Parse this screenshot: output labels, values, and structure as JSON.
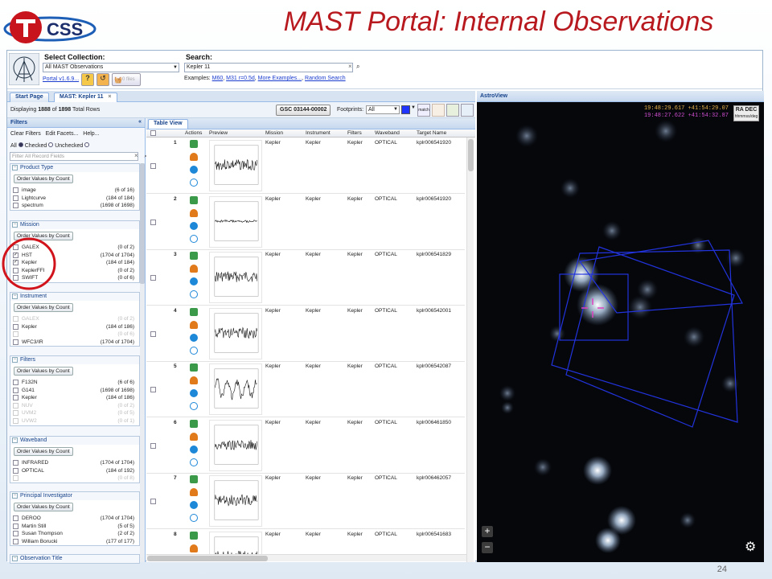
{
  "slide": {
    "title": "MAST Portal: Internal Observations",
    "number": "24",
    "logo_text": "TCSS"
  },
  "topbar": {
    "collection_label": "Select Collection:",
    "collection_value": "All MAST Observations",
    "portal_link": "Portal v1.6.9...",
    "files_btn": "0 files",
    "search_label": "Search:",
    "search_value": "Kepler 11",
    "examples_label": "Examples:",
    "examples": [
      "M60",
      "M31 r=0.5d",
      "More Examples...",
      "Random Search"
    ]
  },
  "tabs": [
    "Start Page",
    "MAST: Kepler 11"
  ],
  "infobar": {
    "displaying": "Displaying",
    "shown": "1888",
    "of": "of",
    "total": "1898",
    "rows_label": "Total Rows",
    "target_btn": "GSC 03144-00002",
    "footprints_label": "Footprints:",
    "footprints_value": "All",
    "match_label": "match"
  },
  "filters": {
    "title": "Filters",
    "clear": "Clear Filters",
    "edit": "Edit Facets...",
    "help": "Help...",
    "all": "All",
    "checked": "Checked",
    "unchecked": "Unchecked",
    "placeholder": "Filter All Record Fields",
    "order_btn": "Order Values by Count",
    "groups": [
      {
        "title": "Product Type",
        "items": [
          {
            "label": "image",
            "count": "(6 of 16)",
            "checked": false,
            "dim": false
          },
          {
            "label": "Lightcurve",
            "count": "(184 of 184)",
            "checked": false,
            "dim": false
          },
          {
            "label": "spectrum",
            "count": "(1698 of 1698)",
            "checked": false,
            "dim": false
          }
        ]
      },
      {
        "title": "Mission",
        "items": [
          {
            "label": "GALEX",
            "count": "(0 of 2)",
            "checked": false,
            "dim": false
          },
          {
            "label": "HST",
            "count": "(1704 of 1704)",
            "checked": true,
            "dim": false
          },
          {
            "label": "Kepler",
            "count": "(184 of 184)",
            "checked": true,
            "dim": false
          },
          {
            "label": "KeplerFFI",
            "count": "(0 of 2)",
            "checked": false,
            "dim": false
          },
          {
            "label": "SWIFT",
            "count": "(0 of 6)",
            "checked": false,
            "dim": false
          }
        ]
      },
      {
        "title": "Instrument",
        "items": [
          {
            "label": "GALEX",
            "count": "(0 of 2)",
            "checked": false,
            "dim": true
          },
          {
            "label": "Kepler",
            "count": "(184 of 186)",
            "checked": false,
            "dim": false
          },
          {
            "label": "",
            "count": "(0 of 6)",
            "checked": false,
            "dim": true
          },
          {
            "label": "WFC3/IR",
            "count": "(1704 of 1704)",
            "checked": false,
            "dim": false
          }
        ]
      },
      {
        "title": "Filters",
        "items": [
          {
            "label": "F132N",
            "count": "(6 of 6)",
            "checked": false,
            "dim": false
          },
          {
            "label": "G141",
            "count": "(1698 of 1698)",
            "checked": false,
            "dim": false
          },
          {
            "label": "Kepler",
            "count": "(184 of 186)",
            "checked": false,
            "dim": false
          },
          {
            "label": "NUV",
            "count": "(0 of 2)",
            "checked": false,
            "dim": true
          },
          {
            "label": "UVM2",
            "count": "(0 of 5)",
            "checked": false,
            "dim": true
          },
          {
            "label": "UVW2",
            "count": "(0 of 1)",
            "checked": false,
            "dim": true
          }
        ]
      },
      {
        "title": "Waveband",
        "items": [
          {
            "label": "INFRARED",
            "count": "(1704 of 1704)",
            "checked": false,
            "dim": false
          },
          {
            "label": "OPTICAL",
            "count": "(184 of 192)",
            "checked": false,
            "dim": false
          },
          {
            "label": "",
            "count": "(0 of 8)",
            "checked": false,
            "dim": true
          }
        ]
      },
      {
        "title": "Principal Investigator",
        "items": [
          {
            "label": "DEROO",
            "count": "(1704 of 1704)",
            "checked": false,
            "dim": false
          },
          {
            "label": "Martin Still",
            "count": "(5 of 5)",
            "checked": false,
            "dim": false
          },
          {
            "label": "Susan Thompson",
            "count": "(2 of 2)",
            "checked": false,
            "dim": false
          },
          {
            "label": "William Borucki",
            "count": "(177 of 177)",
            "checked": false,
            "dim": false
          }
        ]
      }
    ],
    "next_group": "Observation Title"
  },
  "table": {
    "tab": "Table View",
    "columns": [
      "Actions",
      "Preview",
      "Mission",
      "Instrument",
      "Filters",
      "Waveband",
      "Target Name"
    ],
    "rows": [
      {
        "n": "1",
        "mission": "Kepler",
        "instrument": "Kepler",
        "filters": "Kepler",
        "waveband": "OPTICAL",
        "target": "kplr006541920"
      },
      {
        "n": "2",
        "mission": "Kepler",
        "instrument": "Kepler",
        "filters": "Kepler",
        "waveband": "OPTICAL",
        "target": "kplr006541920"
      },
      {
        "n": "3",
        "mission": "Kepler",
        "instrument": "Kepler",
        "filters": "Kepler",
        "waveband": "OPTICAL",
        "target": "kplr006541829"
      },
      {
        "n": "4",
        "mission": "Kepler",
        "instrument": "Kepler",
        "filters": "Kepler",
        "waveband": "OPTICAL",
        "target": "kplr006542001"
      },
      {
        "n": "5",
        "mission": "Kepler",
        "instrument": "Kepler",
        "filters": "Kepler",
        "waveband": "OPTICAL",
        "target": "kplr006542087"
      },
      {
        "n": "6",
        "mission": "Kepler",
        "instrument": "Kepler",
        "filters": "Kepler",
        "waveband": "OPTICAL",
        "target": "kplr006461850"
      },
      {
        "n": "7",
        "mission": "Kepler",
        "instrument": "Kepler",
        "filters": "Kepler",
        "waveband": "OPTICAL",
        "target": "kplr006462057"
      },
      {
        "n": "8",
        "mission": "Kepler",
        "instrument": "Kepler",
        "filters": "Kepler",
        "waveband": "OPTICAL",
        "target": "kplr006541683"
      }
    ]
  },
  "astroview": {
    "title": "AstroView",
    "coord1": "19:48:29.617 +41:54:29.07",
    "coord2": "19:48:27.622 +41:54:32.87",
    "radec": "RA DEC",
    "radec_units": "hhmmss/deg",
    "zoom_in": "+",
    "zoom_out": "−",
    "colors": {
      "coord1": "#e8b24a",
      "coord2": "#d24fd2",
      "footprint": "#2233dd",
      "marker": "#e040c0"
    }
  },
  "icons": [
    "mast-logo-icon",
    "help-icon",
    "cart-icon",
    "search-icon",
    "clear-icon",
    "gear-icon"
  ]
}
